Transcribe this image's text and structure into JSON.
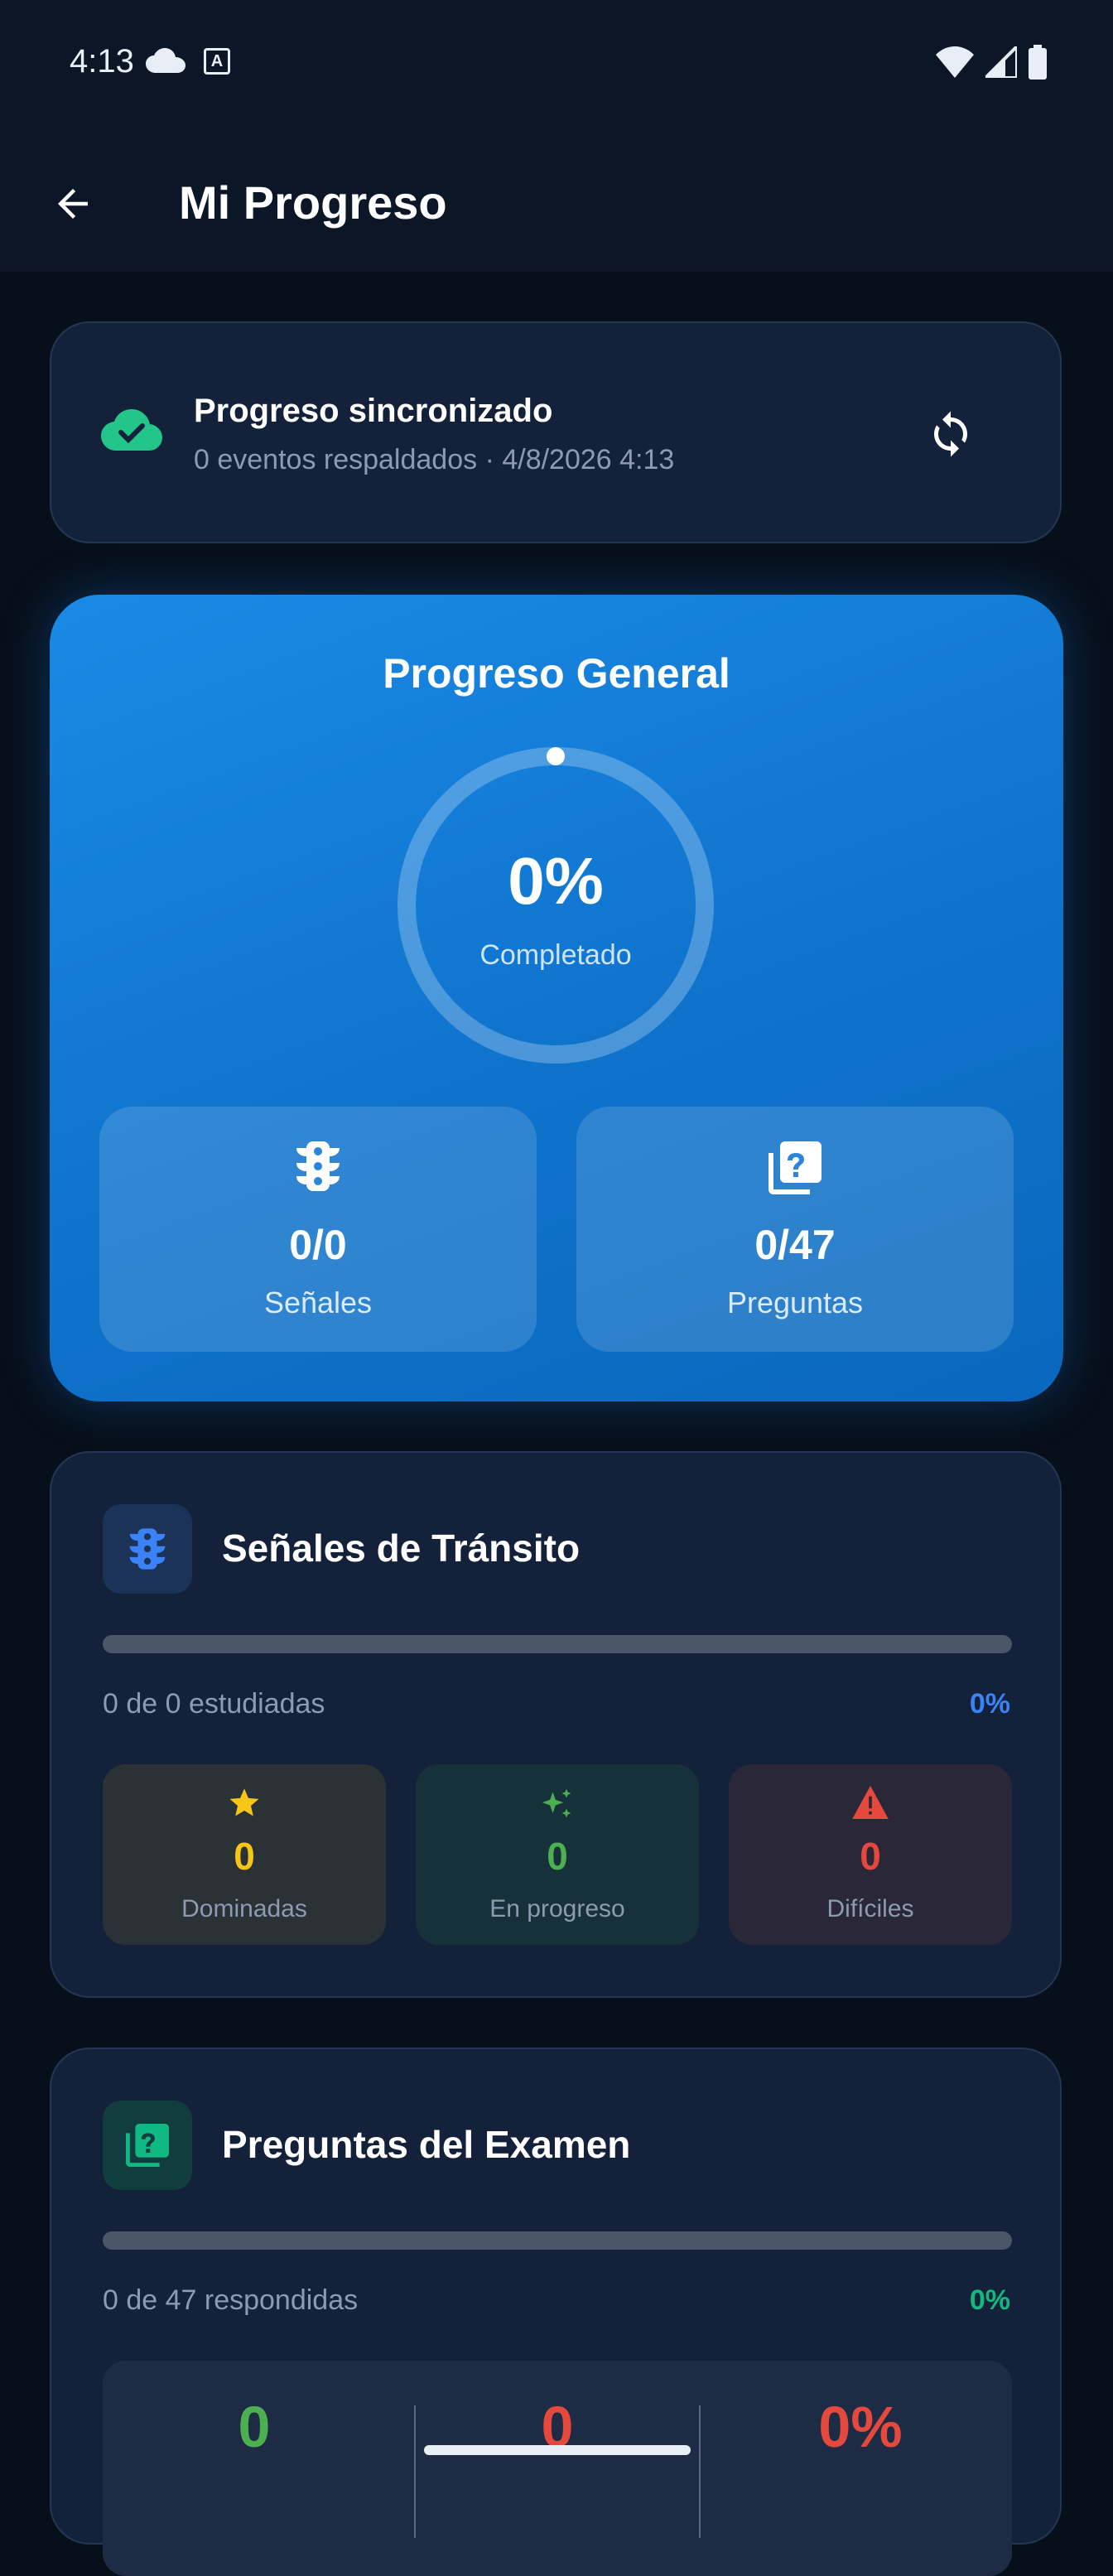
{
  "status_bar": {
    "time": "4:13"
  },
  "app_bar": {
    "title": "Mi Progreso"
  },
  "sync": {
    "title": "Progreso sincronizado",
    "subtitle": "0 eventos respaldados · 4/8/2026 4:13"
  },
  "general": {
    "title": "Progreso General",
    "percent_label": "0%",
    "percent_value": 0,
    "completed_label": "Completado",
    "signals_value": "0/0",
    "signals_label": "Señales",
    "questions_value": "0/47",
    "questions_label": "Preguntas"
  },
  "signals_section": {
    "title": "Señales de Tránsito",
    "progress_text": "0 de 0 estudiadas",
    "progress_pct": "0%",
    "progress_value": 0,
    "accent": "#3b82f6",
    "stats": [
      {
        "value": "0",
        "label": "Dominadas",
        "color": "#f5c518",
        "icon": "star-icon"
      },
      {
        "value": "0",
        "label": "En progreso",
        "color": "#4caf50",
        "icon": "sparkle-icon"
      },
      {
        "value": "0",
        "label": "Difíciles",
        "color": "#e5483c",
        "icon": "warning-icon"
      }
    ]
  },
  "exam_section": {
    "title": "Preguntas del Examen",
    "progress_text": "0 de 47 respondidas",
    "progress_pct": "0%",
    "progress_value": 0,
    "accent": "#10b981",
    "stats": [
      {
        "value": "0",
        "color": "#4caf50"
      },
      {
        "value": "0",
        "color": "#e5483c"
      },
      {
        "value": "0%",
        "color": "#e5483c"
      }
    ]
  }
}
